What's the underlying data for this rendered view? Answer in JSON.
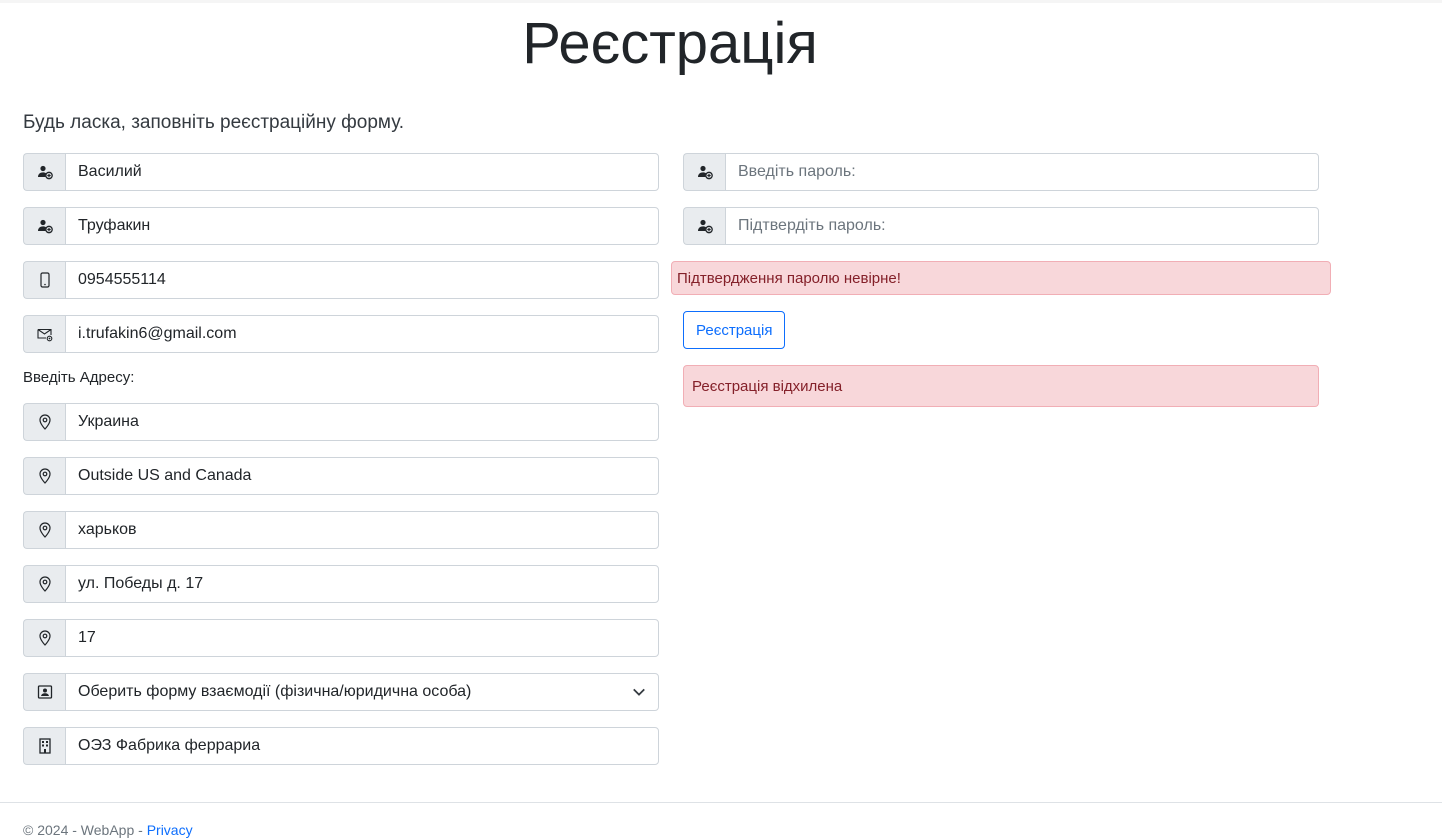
{
  "header": {
    "title": "Реєстрація"
  },
  "form": {
    "lead": "Будь ласка, заповніть реєстраційну форму.",
    "first_name": {
      "value": "Василий",
      "icon": "person-plus-icon"
    },
    "last_name": {
      "value": "Труфакин",
      "icon": "person-plus-icon"
    },
    "phone": {
      "value": "0954555114",
      "icon": "phone-icon"
    },
    "email": {
      "value": "i.trufakin6@gmail.com",
      "icon": "envelope-at-icon"
    },
    "address_label": "Введіть Адресу:",
    "country": {
      "value": "Украина",
      "icon": "geo-pin-icon"
    },
    "region": {
      "value": "Outside US and Canada",
      "icon": "geo-pin-icon"
    },
    "city": {
      "value": "харьков",
      "icon": "geo-pin-icon"
    },
    "street": {
      "value": "ул. Победы д. 17",
      "icon": "geo-pin-icon"
    },
    "house": {
      "value": "17",
      "icon": "geo-pin-icon"
    },
    "interaction_form": {
      "value": "Оберить форму взаємодії (фізична/юридична особа)",
      "icon": "person-badge-icon"
    },
    "company": {
      "value": "ОЭЗ Фабрика феррариа",
      "icon": "building-icon"
    },
    "password": {
      "placeholder": "Введіть пароль:",
      "icon": "person-plus-icon"
    },
    "password_confirm": {
      "placeholder": "Підтвердіть пароль:",
      "icon": "person-plus-icon"
    },
    "password_error": "Підтвердження паролю невірне!",
    "submit_label": "Реєстрація",
    "result_error": "Реєстрація відхилена"
  },
  "footer": {
    "text": "© 2024 - WebApp -",
    "link": "Privacy"
  },
  "colors": {
    "primary": "#0d6efd",
    "danger_bg": "#f8d7da",
    "danger_text": "#842029",
    "addon_bg": "#e9ecef"
  }
}
